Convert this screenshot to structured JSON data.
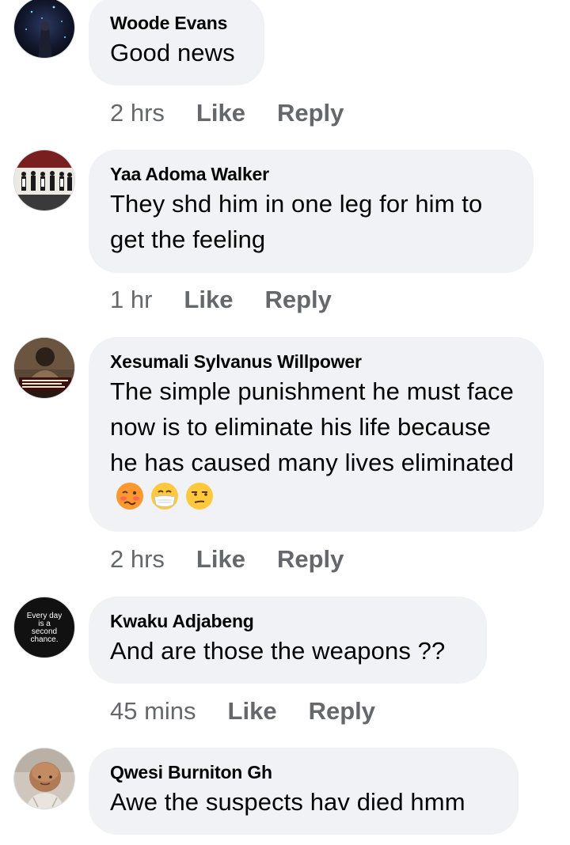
{
  "comments": [
    {
      "author": "Woode Evans",
      "text": "Good news",
      "time": "2 hrs",
      "like": "Like",
      "reply": "Reply"
    },
    {
      "author": "Yaa Adoma Walker",
      "text": "They shd him in one leg for him to get the feeling",
      "time": "1 hr",
      "like": "Like",
      "reply": "Reply"
    },
    {
      "author": "Xesumali Sylvanus Willpower",
      "text": "The simple punishment he must face now is to eliminate his life because he has caused many lives eliminated",
      "emojis": [
        "woozy-face-emoji",
        "face-with-medical-mask-emoji",
        "unamused-face-emoji"
      ],
      "time": "2 hrs",
      "like": "Like",
      "reply": "Reply"
    },
    {
      "author": "Kwaku Adjabeng",
      "text": "And are those the weapons ??",
      "avatar_text": "Every day is a second chance.",
      "time": "45 mins",
      "like": "Like",
      "reply": "Reply"
    },
    {
      "author": "Qwesi Burniton Gh",
      "text": "Awe the suspects hav died hmm"
    }
  ],
  "colors": {
    "bubble": "#f0f2f5",
    "meta_text": "#65676b",
    "text": "#050505"
  }
}
